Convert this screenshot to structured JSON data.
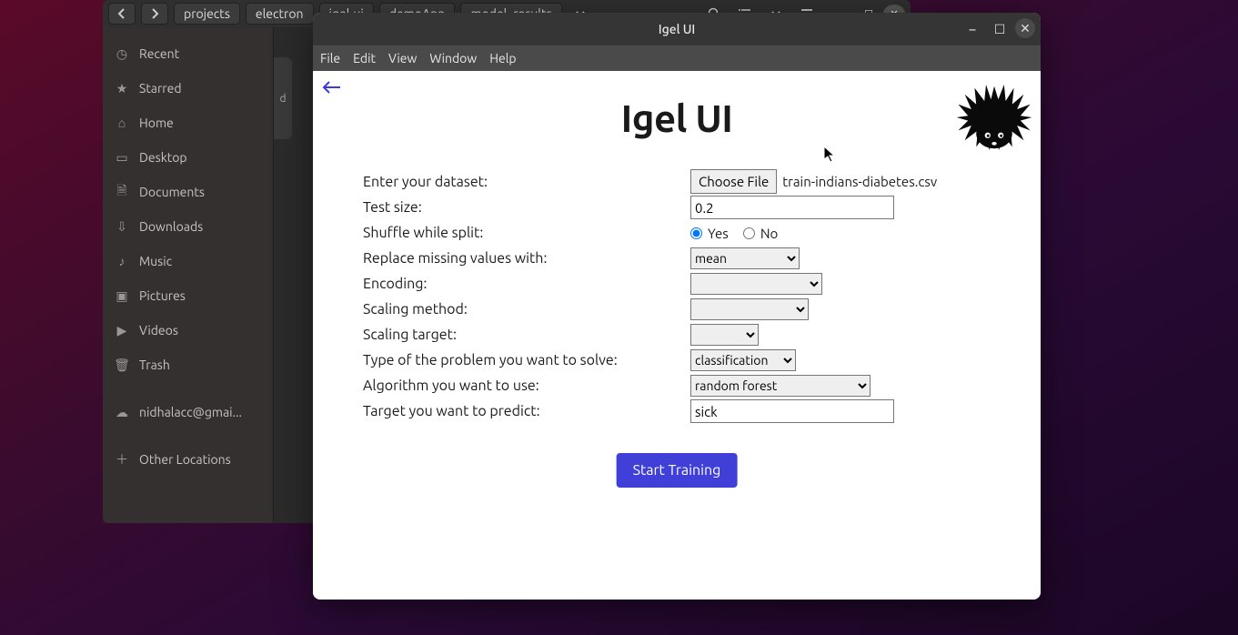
{
  "fileManager": {
    "breadcrumbs": [
      "projects",
      "electron",
      "igel-ui",
      "demoApp",
      "model_results"
    ],
    "sidebar": [
      {
        "icon": "clock",
        "label": "Recent"
      },
      {
        "icon": "star",
        "label": "Starred"
      },
      {
        "icon": "home",
        "label": "Home"
      },
      {
        "icon": "desktop",
        "label": "Desktop"
      },
      {
        "icon": "doc",
        "label": "Documents"
      },
      {
        "icon": "download",
        "label": "Downloads"
      },
      {
        "icon": "music",
        "label": "Music"
      },
      {
        "icon": "picture",
        "label": "Pictures"
      },
      {
        "icon": "video",
        "label": "Videos"
      },
      {
        "icon": "trash",
        "label": "Trash"
      }
    ],
    "account": "nidhalacc@gmai...",
    "other": "Other Locations",
    "snippet": "d"
  },
  "igel": {
    "windowTitle": "Igel UI",
    "menus": [
      "File",
      "Edit",
      "View",
      "Window",
      "Help"
    ],
    "title": "Igel UI",
    "labels": {
      "dataset": "Enter your dataset:",
      "testsize": "Test size:",
      "shuffle": "Shuffle while split:",
      "missing": "Replace missing values with:",
      "encoding": "Encoding:",
      "scalingMethod": "Scaling method:",
      "scalingTarget": "Scaling target:",
      "problem": "Type of the problem you want to solve:",
      "algo": "Algorithm you want to use:",
      "target": "Target you want to predict:"
    },
    "values": {
      "chooseFile": "Choose File",
      "fileName": "train-indians-diabetes.csv",
      "testsize": "0.2",
      "shuffleYes": "Yes",
      "shuffleNo": "No",
      "missing": "mean",
      "encoding": "",
      "scalingMethod": "",
      "scalingTarget": "",
      "problem": "classification",
      "algo": "random forest",
      "target": "sick"
    },
    "startBtn": "Start Training"
  }
}
